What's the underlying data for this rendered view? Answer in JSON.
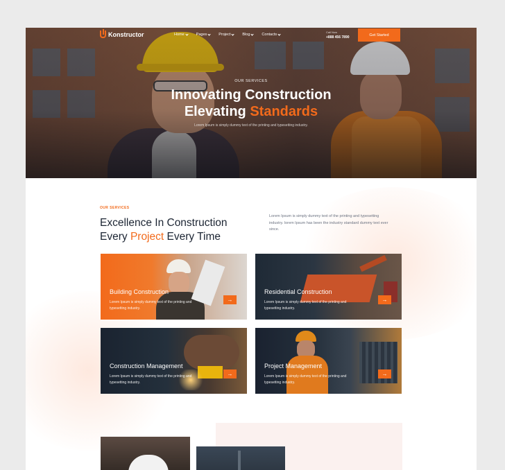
{
  "colors": {
    "accent": "#f26a1b",
    "dark": "#1c2533",
    "page_bg": "#ebebeb"
  },
  "nav": {
    "logo_text": "Konstructor",
    "items": [
      {
        "label": "Home",
        "icon": "chevron-down-icon"
      },
      {
        "label": "Pages",
        "icon": "chevron-down-icon"
      },
      {
        "label": "Project",
        "icon": "chevron-down-icon"
      },
      {
        "label": "Blog",
        "icon": "chevron-down-icon"
      },
      {
        "label": "Contacts",
        "icon": "chevron-down-icon"
      }
    ],
    "call_label": "Call Now",
    "call_number": "+888 456 7890",
    "cta_label": "Get Started"
  },
  "hero": {
    "eyebrow": "OUR SERVICES",
    "title_line1": "Innovating Construction",
    "title_line2_plain": "Elevating",
    "title_line2_accent": "Standards",
    "subtitle": "Lorem Ipsum is simply dummy text of the printing and typesetting industry."
  },
  "services": {
    "eyebrow": "OUR SERVICES",
    "title_line1": "Excellence In Construction",
    "title_line2_pre": "Every",
    "title_line2_accent": "Project",
    "title_line2_post": "Every Time",
    "description": "Lorem Ipsum is simply dummy text of the printing and typesetting industry. lorem Ipsum has been the industry standard dummy text ever since.",
    "cards": [
      {
        "title": "Building Construction",
        "text": "Lorem Ipsum is simply dummy text of the printing and typesetting industry.",
        "arrow": "→"
      },
      {
        "title": "Residential Construction",
        "text": "Lorem Ipsum is simply dummy text of the printing and typesetting industry.",
        "arrow": "→"
      },
      {
        "title": "Construction Management",
        "text": "Lorem Ipsum is simply dummy text of the printing and typesetting industry.",
        "arrow": "→"
      },
      {
        "title": "Project Management",
        "text": "Lorem Ipsum is simply dummy text of the printing and typesetting industry.",
        "arrow": "→"
      }
    ]
  }
}
